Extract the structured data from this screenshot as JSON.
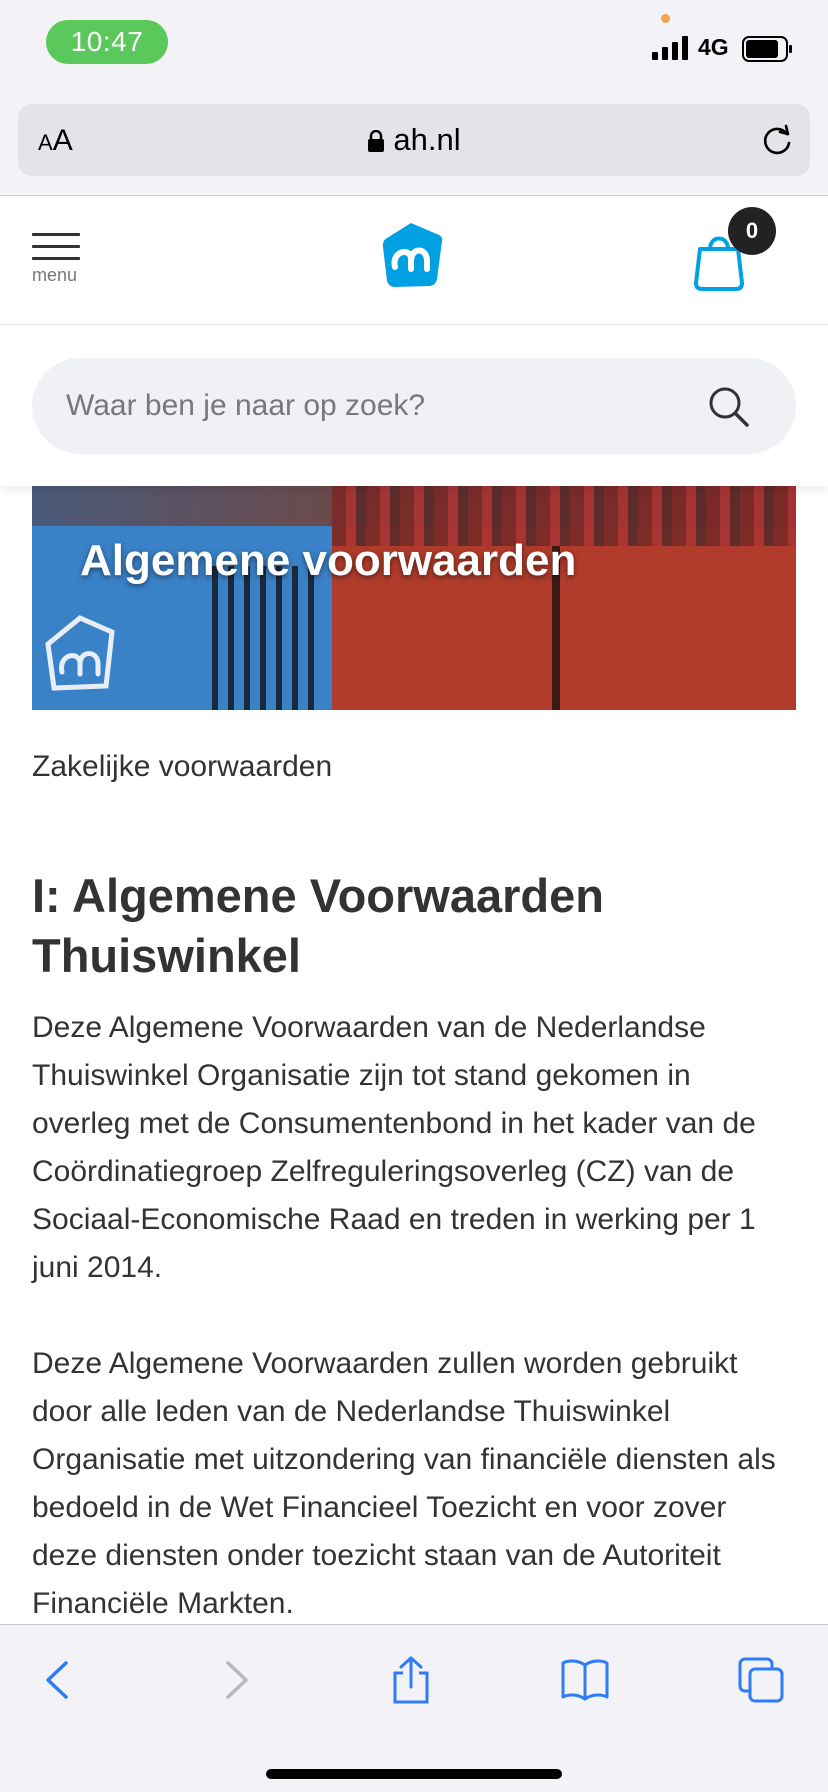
{
  "status_bar": {
    "time": "10:47",
    "network": "4G"
  },
  "browser": {
    "text_size_label_small": "A",
    "text_size_label_large": "A",
    "url": "ah.nl"
  },
  "header": {
    "menu_label": "menu",
    "cart_count": "0",
    "brand_color": "#00a0e2"
  },
  "search": {
    "placeholder": "Waar ben je naar op zoek?"
  },
  "hero": {
    "title": "Algemene voorwaarden"
  },
  "content": {
    "subtitle": "Zakelijke voorwaarden",
    "heading": "I: Algemene Voorwaarden Thuiswinkel",
    "paragraphs": [
      "Deze Algemene Voorwaarden van de Nederlandse Thuiswinkel Organisatie zijn tot stand gekomen in overleg met de Consumentenbond in het kader van de Coördinatiegroep Zelfreguleringsoverleg (CZ) van de Sociaal-Economische Raad en treden in werking per 1 juni 2014.",
      "Deze Algemene Voorwaarden zullen worden gebruikt door alle leden van de Nederlandse Thuiswinkel Organisatie met uitzondering van financiële diensten als bedoeld in de Wet Financieel Toezicht en voor zover deze diensten onder toezicht staan van de Autoriteit Financiële Markten."
    ]
  },
  "toolbar": {
    "icons": [
      "back-icon",
      "forward-icon",
      "share-icon",
      "bookmarks-icon",
      "tabs-icon"
    ],
    "accent_color": "#2f7cf6"
  }
}
